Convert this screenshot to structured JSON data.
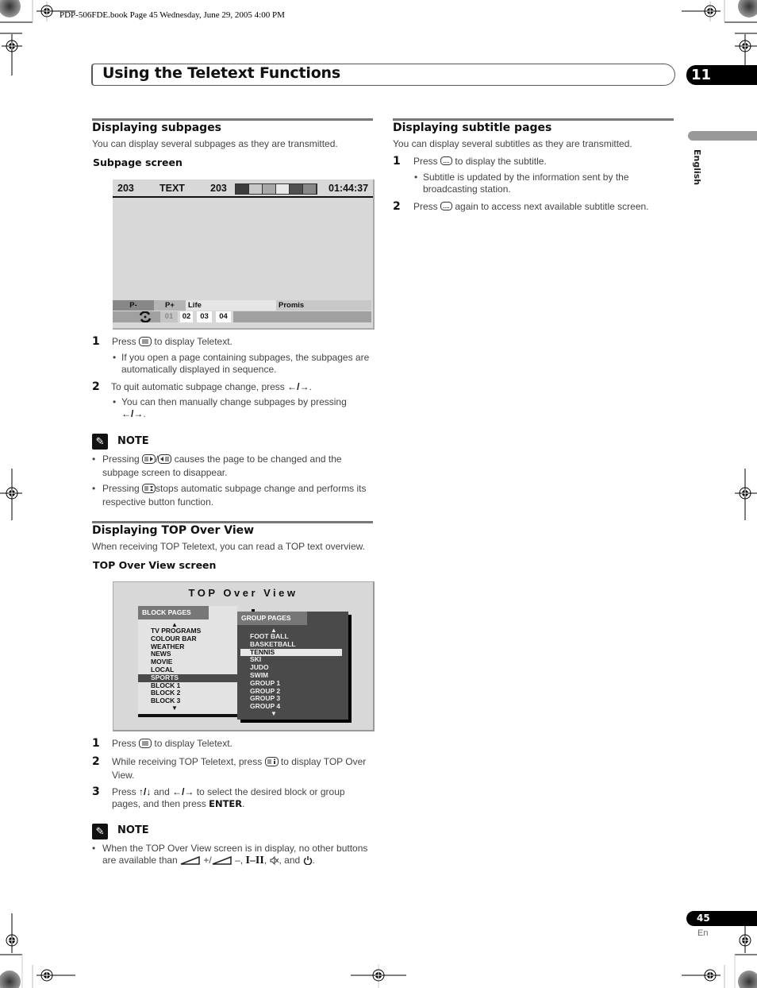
{
  "print_header": "PDP-506FDE.book  Page 45  Wednesday, June 29, 2005  4:00 PM",
  "chapter": {
    "title": "Using the Teletext Functions",
    "number": "11"
  },
  "side_tab": {
    "language": "English"
  },
  "left": {
    "subpages": {
      "title": "Displaying subpages",
      "intro": "You can display several subpages as they are transmitted.",
      "screen_label": "Subpage screen",
      "screen": {
        "page": "203",
        "mode": "TEXT",
        "page2": "203",
        "time": "01:44:37",
        "color_bar": [
          "#3c3c3c",
          "#c8c8c8",
          "#a8a8a8",
          "#e8e8e8",
          "#505050",
          "#888888"
        ],
        "row1": {
          "pminus": "P-",
          "pplus": "P+",
          "left_label": "Life",
          "right_label": "Promis"
        },
        "subpage_icon": "subpage-rotate-icon",
        "subpages": [
          "01",
          "02",
          "03",
          "04"
        ]
      },
      "steps": [
        {
          "num": "1",
          "pre": "Press",
          "icon": "teletext-icon",
          "post": "to display Teletext.",
          "bullet": "If you open a page containing subpages, the subpages are automatically displayed in sequence."
        },
        {
          "num": "2",
          "pre": "To quit automatic subpage change, press",
          "icon_text": "←/→",
          "post": ".",
          "bullet_pre": "You can then manually change subpages by pressing",
          "bullet_icon_text": "←/→",
          "bullet_post": "."
        }
      ],
      "note": {
        "label": "NOTE",
        "items": [
          {
            "pre": "Pressing",
            "icons": "page-up/page-down",
            "post": "causes the page to be changed and the subpage screen to disappear."
          },
          {
            "pre": "Pressing",
            "icons": "hold",
            "post": "stops automatic subpage change and performs its respective button function."
          }
        ]
      }
    },
    "top_over_view": {
      "title": "Displaying TOP Over View",
      "intro": "When receiving TOP Teletext, you can read a TOP text overview.",
      "screen_label": "TOP Over View screen",
      "screen": {
        "title": "TOP Over View",
        "block_header": "BLOCK PAGES",
        "block_items": [
          "TV PROGRAMS",
          "COLOUR BAR",
          "WEATHER",
          "NEWS",
          "MOVIE",
          "LOCAL",
          "SPORTS",
          "BLOCK 1",
          "BLOCK 2",
          "BLOCK 3"
        ],
        "block_selected": "SPORTS",
        "group_header": "GROUP PAGES",
        "group_items": [
          "FOOT BALL",
          "BASKETBALL",
          "TENNIS",
          "SKI",
          "JUDO",
          "SWIM",
          "GROUP 1",
          "GROUP 2",
          "GROUP 3",
          "GROUP 4"
        ],
        "group_selected": "TENNIS"
      },
      "steps": [
        {
          "num": "1",
          "pre": "Press",
          "post": "to display Teletext."
        },
        {
          "num": "2",
          "pre": "While receiving TOP Teletext, press",
          "post": "to display TOP Over View."
        },
        {
          "num": "3",
          "pre": "Press",
          "arrows1": "↑/↓",
          "mid": "and",
          "arrows2": "←/→",
          "post": "to select the desired block or group pages, and then press",
          "bold": "ENTER",
          "end": "."
        }
      ],
      "note": {
        "label": "NOTE",
        "text_pre": "When the TOP Over View screen is in display, no other buttons are available than",
        "vol_plus": "+/",
        "vol_minus": "–,",
        "audio": "I–II",
        "and": ", and",
        "end": "."
      }
    }
  },
  "right": {
    "subtitles": {
      "title": "Displaying subtitle pages",
      "intro": "You can display several subtitles as they are transmitted.",
      "steps": [
        {
          "num": "1",
          "pre": "Press",
          "post": "to display the subtitle.",
          "bullet": "Subtitle is updated by the information sent by the broadcasting station."
        },
        {
          "num": "2",
          "pre": "Press",
          "post": "again to access next available subtitle screen."
        }
      ]
    }
  },
  "footer": {
    "page_number": "45",
    "lang_code": "En"
  }
}
